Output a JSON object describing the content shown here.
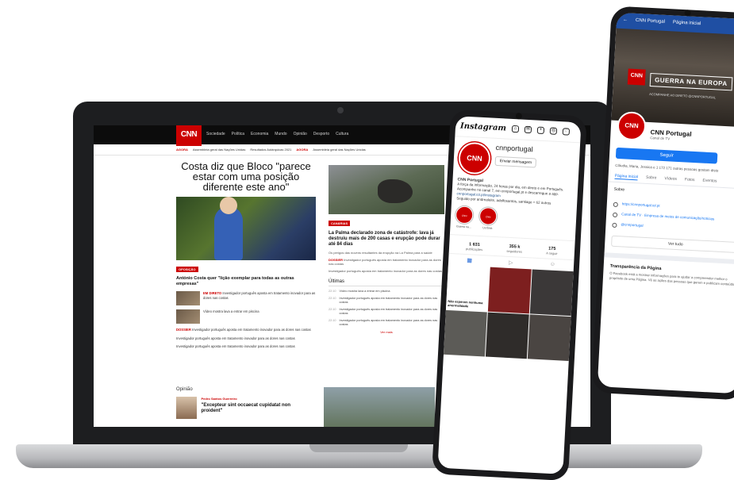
{
  "laptop": {
    "logo": "CNN",
    "nav": [
      "Sociedade",
      "Política",
      "Economia",
      "Mundo",
      "Opinião",
      "Desporto",
      "Cultura"
    ],
    "ticker": [
      {
        "tag": "AGORA",
        "text": "Assembleia geral das Nações Unidas"
      },
      {
        "tag": "",
        "text": "Resultados Autárquicas 2021"
      },
      {
        "tag": "AGORA",
        "text": "Assembleia geral das Nações Unidas"
      }
    ],
    "headline": "Costa diz que Bloco \"parece estar com uma posição diferente este ano\"",
    "hero_label": "OPOSIÇÃO",
    "hero_caption": "António Costa quer \"lição exemplar para todas as outras empresas\"",
    "side_items": [
      {
        "tag": "EM DIRETO",
        "text": "Investigador português aposta em tratamento inovador para as dores nas costas"
      },
      {
        "tag": "",
        "text": "Vídeo mostra lava a entrar em piscina"
      }
    ],
    "plain_items": [
      {
        "tag": "DOSSIER",
        "text": "Investigador português aposta em tratamento inovador para as dores nas costas"
      },
      {
        "tag": "",
        "text": "Investigador português aposta em tratamento inovador para as dores nas costas"
      },
      {
        "tag": "",
        "text": "Investigador português aposta em tratamento inovador para as dores nas costas"
      }
    ],
    "second_label": "CANÁRIAS",
    "second_headline": "La Palma declarado zona de catástrofe: lava já destruiu mais de 200 casas e erupção pode durar até 84 dias",
    "second_small": "Os perigos das nuvens resultantes da erupção na La Palma para a saúde",
    "second_dossier": {
      "tag": "DOSSIER",
      "text": "Investigador português aposta em tratamento inovador para as dores nas costas"
    },
    "second_plain": "Investigador português aposta em tratamento inovador para as dores nas costas",
    "ultimas_title": "Últimas",
    "ultimas": [
      {
        "time": "22:10",
        "text": "Vídeo mostra lava a entrar em piscina"
      },
      {
        "time": "22:10",
        "text": "Investigador português aposta em tratamento inovador para as dores nas costas"
      },
      {
        "time": "22:10",
        "text": "Investigador português aposta em tratamento inovador para as dores nas costas"
      },
      {
        "time": "22:10",
        "text": "Investigador português aposta em tratamento inovador para as dores nas costas"
      }
    ],
    "ver_mais": "Ver mais",
    "opiniao_title": "Opinião",
    "opiniao_author": "Pedro Santos Guerreiro",
    "opiniao_quote": "\"Excepteur sint occaecat cupidatat non proident\""
  },
  "instagram": {
    "logo": "Instagram",
    "handle": "cnnportugal",
    "avatar": "CNN",
    "message_btn": "Enviar mensagem",
    "bio_name": "CNN Portugal",
    "bio_text": "A força da informação, 24 horas por dia, em direto e em Português. Acompanhe no canal 7, em cnnportugal.pt e descarregue a app.",
    "bio_link": "cnnportugal.iol.pt/instagram",
    "followed_by": "Seguido por andrealeite, adolfosantos, santiago + 62 outros",
    "highlights": [
      "Guerra na...",
      "Ucrânia"
    ],
    "stats": [
      {
        "num": "1 631",
        "label": "publicações"
      },
      {
        "num": "355 k",
        "label": "seguidores"
      },
      {
        "num": "175",
        "label": "A seguir"
      }
    ],
    "posts": [
      {
        "cap": "Não esperem nenhuma anormalidade",
        "bg": "#ffffff",
        "white": true
      },
      {
        "cap": "",
        "bg": "#7d1f1f",
        "white": false
      },
      {
        "cap": "",
        "bg": "#3b3838",
        "white": false
      },
      {
        "cap": "",
        "bg": "#5c5b57",
        "white": false
      },
      {
        "cap": "",
        "bg": "#2f2c2a",
        "white": false
      },
      {
        "cap": "",
        "bg": "#4a4542",
        "white": false
      }
    ]
  },
  "facebook": {
    "header_title": "CNN Portugal",
    "header_tab": "Página inicial",
    "banner": "GUERRA NA EUROPA",
    "banner_sub": "ACOMPANHE AO DIRETO @CNNPORTUGAL",
    "avatar": "CNN",
    "name": "CNN Portugal",
    "category": "Canal de TV",
    "follow_btn": "Seguir",
    "friends": "Cláudia, Maria, Jessica e 1 172 171 outras pessoas gostam disto",
    "tabs": [
      "Página inicial",
      "Sobre",
      "Vídeos",
      "Fotos",
      "Eventos"
    ],
    "about_title": "Sobre",
    "about_rows": [
      "https://cnnportugal.iol.pt",
      "Canal de TV · Empresa de meios de comunicação/notícias",
      "@cnnportugal"
    ],
    "see_all": "Ver tudo",
    "transparency_title": "Transparência da Página",
    "transparency_text": "O Facebook está a mostrar informações para te ajudar a compreender melhor o propósito de uma Página. Vê as ações das pessoas que gerem e publicam conteúdos."
  }
}
